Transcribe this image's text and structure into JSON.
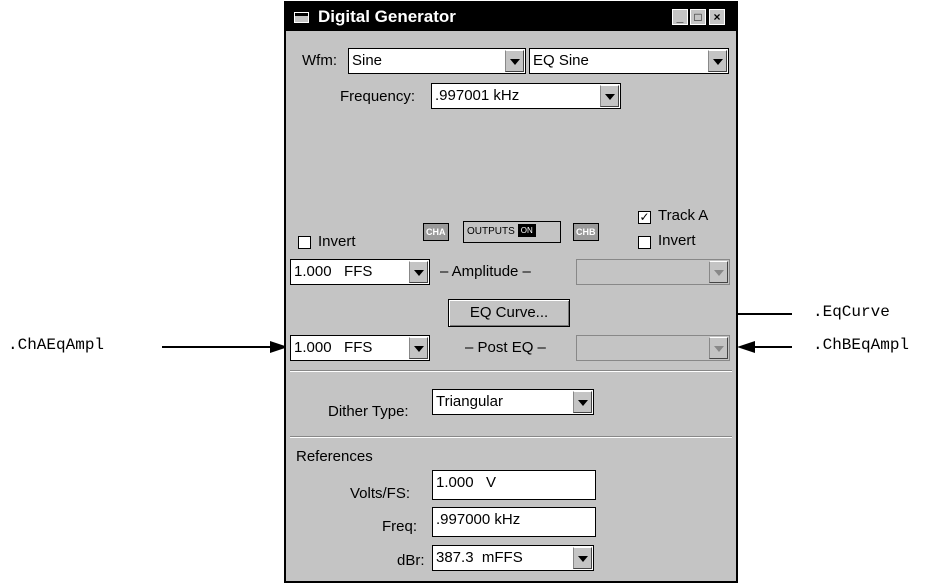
{
  "window": {
    "title": "Digital Generator",
    "title_buttons": [
      "_",
      "□",
      "×"
    ]
  },
  "waveform": {
    "label": "Wfm:",
    "value": "Sine",
    "eq_value": "EQ Sine"
  },
  "frequency": {
    "label": "Frequency:",
    "value": ".997001 kHz"
  },
  "outputs": {
    "invert_a_label": "Invert",
    "invert_a_checked": false,
    "cha_badge": "CHA",
    "outputs_label": "OUTPUTS",
    "outputs_state": "ON",
    "chb_badge": "CHB",
    "track_a_label": "Track A",
    "track_a_checked": true,
    "invert_b_label": "Invert",
    "invert_b_checked": false
  },
  "amplitude": {
    "label": "– Amplitude –",
    "cha_value": "1.000   FFS",
    "chb_value": ""
  },
  "eq_curve_button": "EQ Curve...",
  "post_eq": {
    "label": "– Post EQ –",
    "cha_value": "1.000   FFS",
    "chb_value": ""
  },
  "dither": {
    "label": "Dither Type:",
    "value": "Triangular"
  },
  "references": {
    "heading": "References",
    "volts_label": "Volts/FS:",
    "volts_value": "1.000   V",
    "freq_label": "Freq:",
    "freq_value": ".997000 kHz",
    "dbr_label": "dBr:",
    "dbr_value": "387.3  mFFS"
  },
  "callouts": {
    "eq_curve": ".EqCurve",
    "cha_eq_ampl": ".ChAEqAmpl",
    "chb_eq_ampl": ".ChBEqAmpl"
  }
}
